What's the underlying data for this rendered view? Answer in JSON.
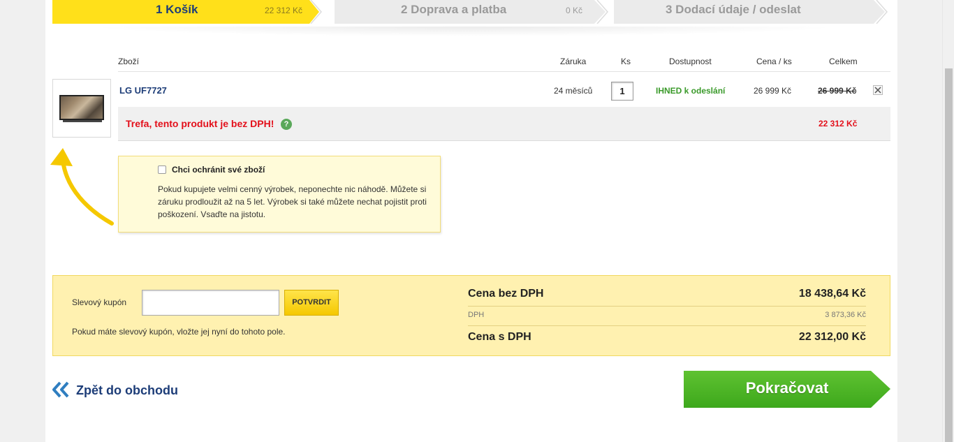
{
  "steps": [
    {
      "label": "1 Košík",
      "price": "22 312 Kč"
    },
    {
      "label": "2 Doprava a platba",
      "price": "0 Kč"
    },
    {
      "label": "3 Dodací údaje / odeslat"
    }
  ],
  "table": {
    "headers": {
      "item": "Zboží",
      "warranty": "Záruka",
      "qty": "Ks",
      "availability": "Dostupnost",
      "unit_price": "Cena / ks",
      "total": "Celkem"
    }
  },
  "product": {
    "name": "LG UF7727",
    "warranty": "24 měsíců",
    "qty": "1",
    "availability": "IHNED k odeslání",
    "unit_price": "26 999 Kč",
    "old_total": "26 999 Kč",
    "remove_icon": "close-icon"
  },
  "promo": {
    "text": "Trefa, tento produkt je bez DPH!",
    "help": "?",
    "price": "22 312 Kč"
  },
  "protection": {
    "checkbox_label": "Chci ochránit své zboží",
    "checked": false,
    "description": "Pokud kupujete velmi cenný výrobek, neponechte nic náhodě. Můžete si záruku prodloužit až na 5 let. Výrobek si také můžete nechat pojistit proti poškození. Vsaďte na jistotu."
  },
  "coupon": {
    "label": "Slevový kupón",
    "value": "",
    "button": "POTVRDIT",
    "note": "Pokud máte slevový kupón, vložte jej nyní do tohoto pole."
  },
  "summary": {
    "without_vat_label": "Cena bez DPH",
    "without_vat": "18 438,64 Kč",
    "vat_label": "DPH",
    "vat": "3 873,36 Kč",
    "with_vat_label": "Cena s DPH",
    "with_vat": "22 312,00 Kč"
  },
  "nav": {
    "back": "Zpět do obchodu",
    "continue": "Pokračovat"
  },
  "colors": {
    "brand_yellow": "#ffe01a",
    "brand_blue": "#1d3d78",
    "promo_red": "#e3101b",
    "available_green": "#3a9a2a",
    "continue_green": "#4bb524"
  }
}
